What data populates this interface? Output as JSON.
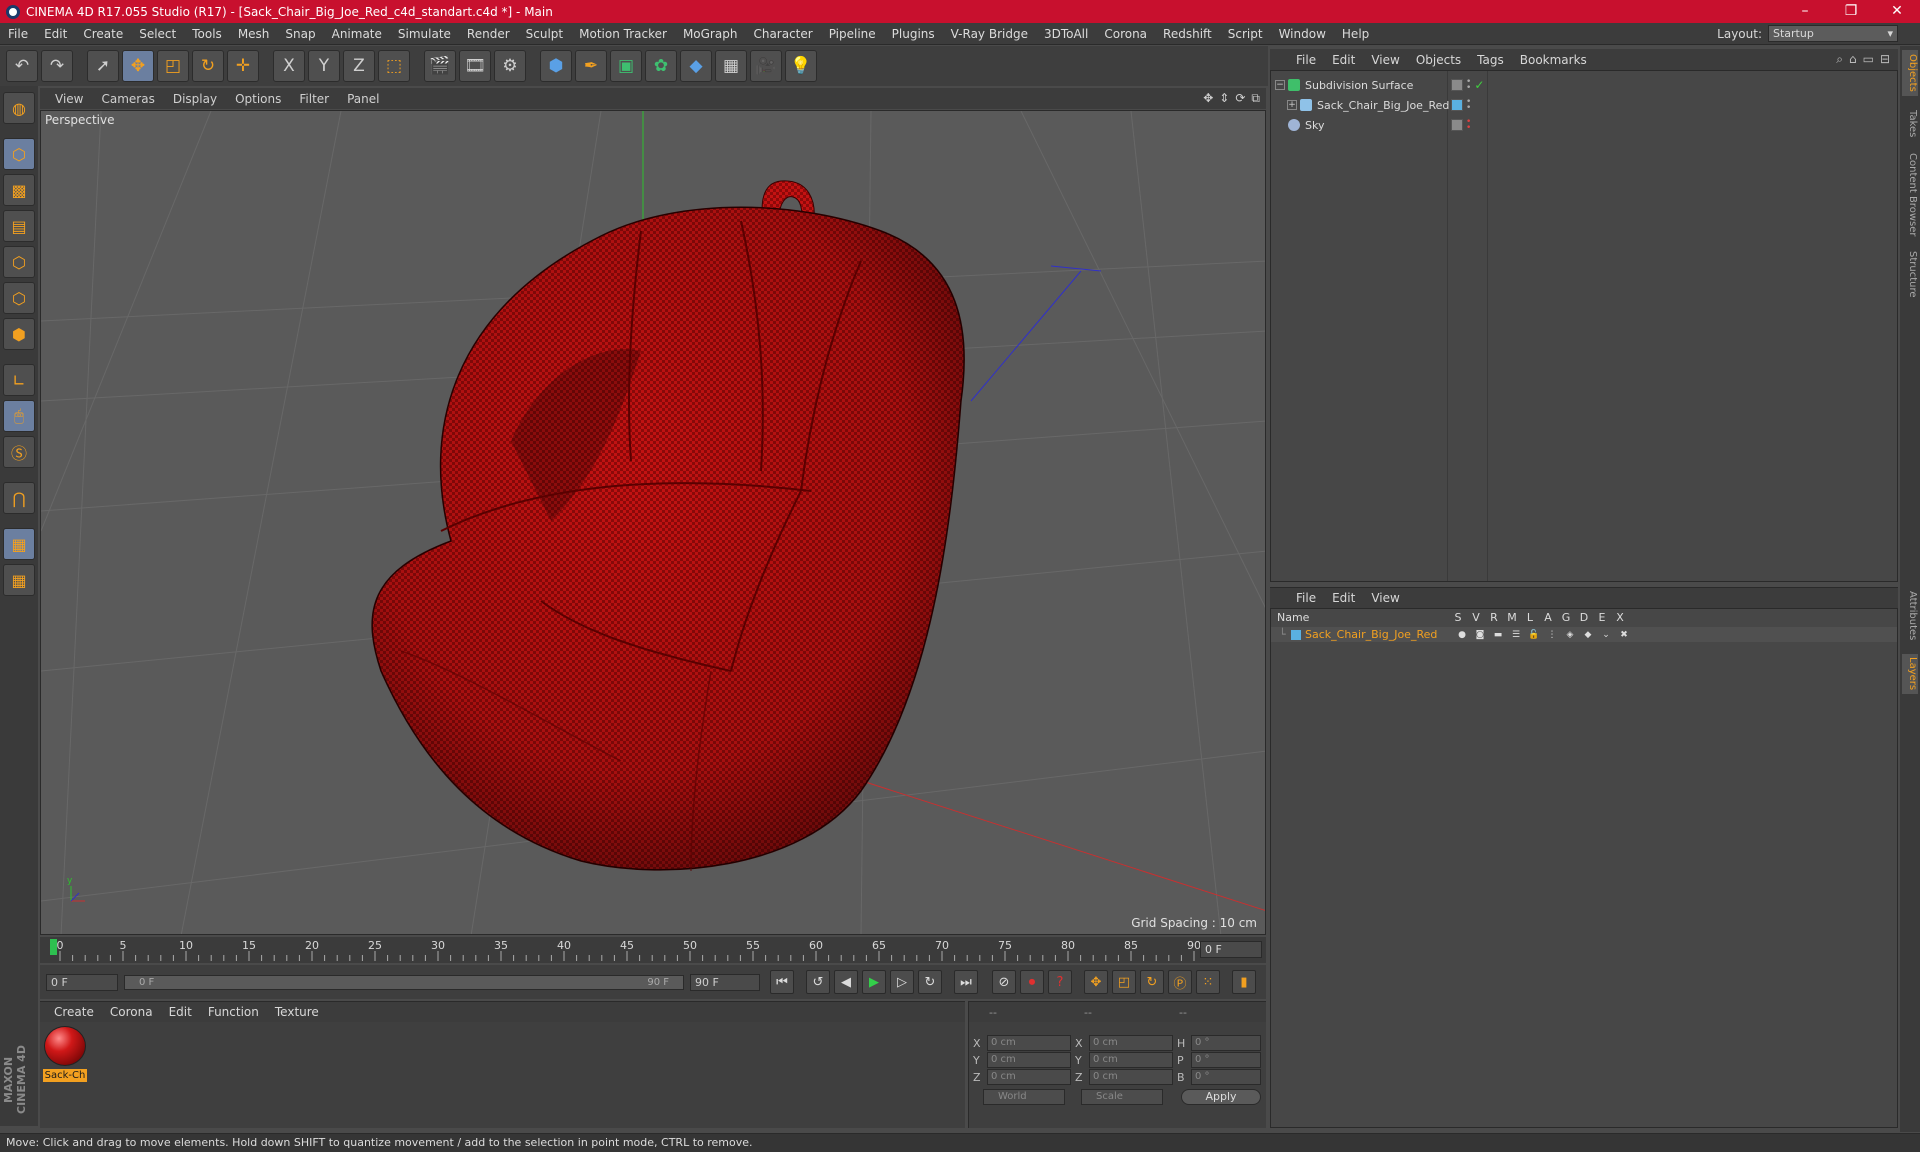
{
  "window": {
    "title": "CINEMA 4D R17.055 Studio (R17) - [Sack_Chair_Big_Joe_Red_c4d_standart.c4d *] - Main",
    "minimize": "–",
    "maximize": "❐",
    "close": "✕"
  },
  "menubar": {
    "items": [
      "File",
      "Edit",
      "Create",
      "Select",
      "Tools",
      "Mesh",
      "Snap",
      "Animate",
      "Simulate",
      "Render",
      "Sculpt",
      "Motion Tracker",
      "MoGraph",
      "Character",
      "Pipeline",
      "Plugins",
      "V-Ray Bridge",
      "3DToAll",
      "Corona",
      "Redshift",
      "Script",
      "Window",
      "Help"
    ],
    "layout_label": "Layout:",
    "layout_value": "Startup"
  },
  "toolbar": {
    "axis_x": "X",
    "axis_y": "Y",
    "axis_z": "Z"
  },
  "viewport": {
    "menu": [
      "View",
      "Cameras",
      "Display",
      "Options",
      "Filter",
      "Panel"
    ],
    "label": "Perspective",
    "grid_spacing": "Grid Spacing : 10 cm"
  },
  "timeline": {
    "ticks": [
      "0",
      "5",
      "10",
      "15",
      "20",
      "25",
      "30",
      "35",
      "40",
      "45",
      "50",
      "55",
      "60",
      "65",
      "70",
      "75",
      "80",
      "85",
      "90"
    ],
    "current_frame": "0 F"
  },
  "transport": {
    "start_field": "0 F",
    "slider_start": "0 F",
    "slider_end": "90 F",
    "end_field": "90 F"
  },
  "material_manager": {
    "menu": [
      "Create",
      "Corona",
      "Edit",
      "Function",
      "Texture"
    ],
    "material_name": "Sack-Ch"
  },
  "coordinates": {
    "headers": [
      "--",
      "--",
      "--"
    ],
    "rows": [
      {
        "a1": "X",
        "v1": "0 cm",
        "a2": "X",
        "v2": "0 cm",
        "a3": "H",
        "v3": "0 °"
      },
      {
        "a1": "Y",
        "v1": "0 cm",
        "a2": "Y",
        "v2": "0 cm",
        "a3": "P",
        "v3": "0 °"
      },
      {
        "a1": "Z",
        "v1": "0 cm",
        "a2": "Z",
        "v2": "0 cm",
        "a3": "B",
        "v3": "0 °"
      }
    ],
    "world": "World",
    "scale": "Scale",
    "apply": "Apply"
  },
  "status": "Move: Click and drag to move elements. Hold down SHIFT to quantize movement / add to the selection in point mode, CTRL to remove.",
  "object_manager": {
    "menu": [
      "File",
      "Edit",
      "View",
      "Objects",
      "Tags",
      "Bookmarks"
    ],
    "objects": [
      {
        "name": "Subdivision Surface",
        "icon_color": "#3fbf6a"
      },
      {
        "name": "Sack_Chair_Big_Joe_Red",
        "icon_color": "#8fc2e8"
      },
      {
        "name": "Sky",
        "icon_color": "#9fb4d6"
      }
    ]
  },
  "layer_manager": {
    "menu": [
      "File",
      "Edit",
      "View"
    ],
    "name_header": "Name",
    "flag_headers": [
      "S",
      "V",
      "R",
      "M",
      "L",
      "A",
      "G",
      "D",
      "E",
      "X"
    ],
    "layer_name": "Sack_Chair_Big_Joe_Red"
  },
  "side_tabs": [
    "Objects",
    "Takes",
    "Content Browser",
    "Structure",
    "Attributes",
    "Layers"
  ],
  "branding": "MAXON CINEMA 4D",
  "colors": {
    "titlebar": "#c8102e",
    "accent": "#f2a020",
    "chair_red": "#c41212"
  }
}
